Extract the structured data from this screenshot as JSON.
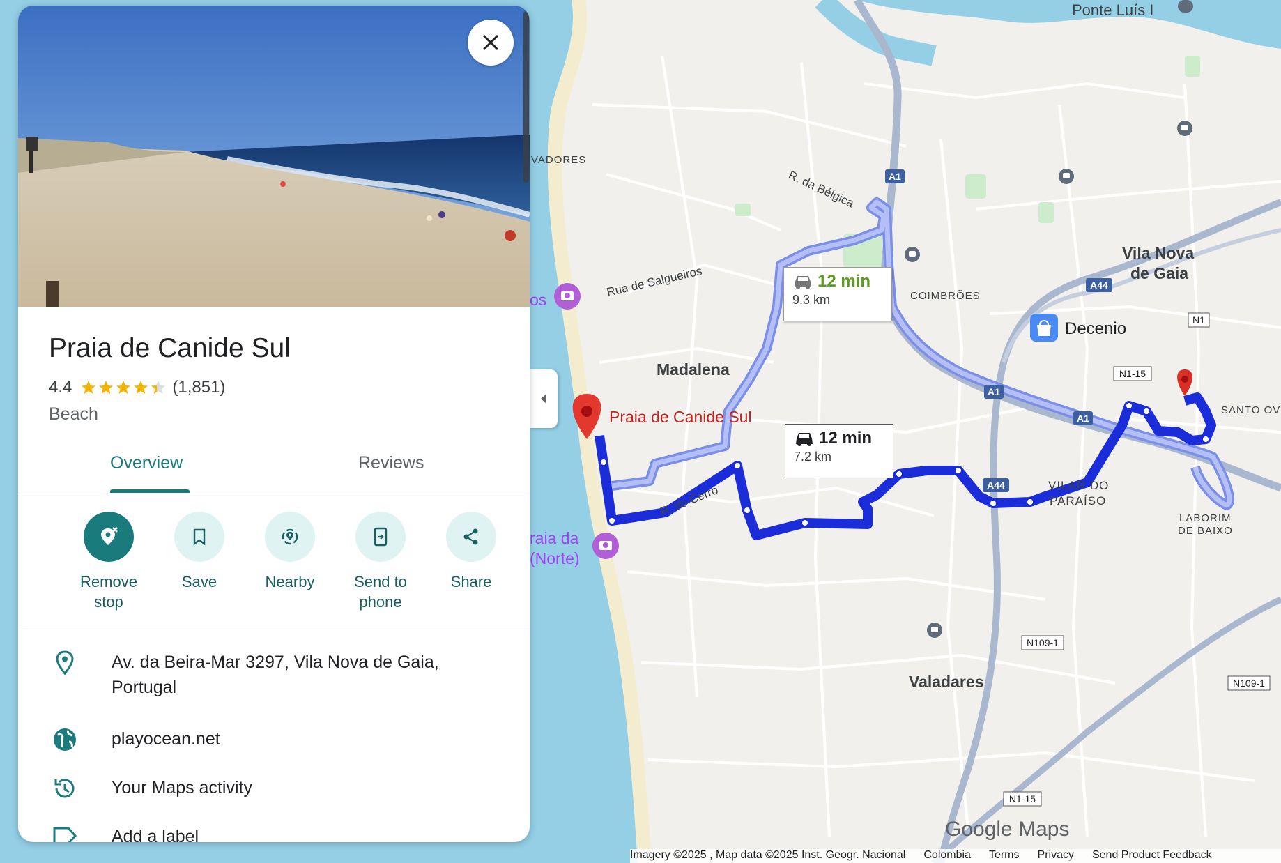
{
  "place": {
    "name": "Praia de Canide Sul",
    "rating": "4.4",
    "stars": 4.4,
    "reviews_count": "(1,851)",
    "category": "Beach"
  },
  "tabs": {
    "overview": "Overview",
    "reviews": "Reviews"
  },
  "actions": [
    {
      "label_line1": "Remove",
      "label_line2": "stop",
      "icon": "remove-stop-icon"
    },
    {
      "label_line1": "Save",
      "label_line2": "",
      "icon": "bookmark-icon"
    },
    {
      "label_line1": "Nearby",
      "label_line2": "",
      "icon": "nearby-icon"
    },
    {
      "label_line1": "Send to",
      "label_line2": "phone",
      "icon": "send-to-phone-icon"
    },
    {
      "label_line1": "Share",
      "label_line2": "",
      "icon": "share-icon"
    }
  ],
  "info": {
    "address": "Av. da Beira-Mar 3297, Vila Nova de Gaia, Portugal",
    "website": "playocean.net",
    "activity": "Your Maps activity",
    "label": "Add a label"
  },
  "routes": [
    {
      "duration": "12 min",
      "distance": "9.3 km",
      "icon": "car-icon",
      "color": "#5b9b1e"
    },
    {
      "duration": "12 min",
      "distance": "7.2 km",
      "icon": "car-icon",
      "color": "#202124"
    }
  ],
  "map_labels": {
    "ponte": "Ponte Luís I",
    "vadores": "VADORES",
    "r_belgica": "R. da Bélgica",
    "rua_salgueiros": "Rua de Salgueiros",
    "madalena": "Madalena",
    "coimbroes": "COIMBRÕES",
    "vila_nova_1": "Vila Nova",
    "vila_nova_2": "de Gaia",
    "decenio": "Decenio",
    "santo_ov": "SANTO OV",
    "laborim_1": "LABORIM",
    "laborim_2": "DE BAIXO",
    "vilar_1": "VILAR DO",
    "vilar_2": "PARAÍSO",
    "r_cerro": "R. do Cerro",
    "praia_norte_1": "raia da",
    "praia_norte_2": "(Norte)",
    "os": "os",
    "valadares": "Valadares",
    "marker_label": "Praia de Canide Sul",
    "google_maps": "Google Maps"
  },
  "road_shields": {
    "a1_top": "A1",
    "a44_top": "A44",
    "n1": "N1",
    "n1_15": "N1-15",
    "a1_mid": "A1",
    "a1_right": "A1",
    "a44_mid": "A44",
    "n109_1": "N109-1",
    "n109_1_right": "N109-1",
    "n1_15_bottom": "N1-15"
  },
  "footer": {
    "imagery": "Imagery ©2025 , Map data ©2025 Inst. Geogr. Nacional",
    "country": "Colombia",
    "terms": "Terms",
    "privacy": "Privacy",
    "feedback": "Send Product Feedback"
  },
  "colors": {
    "accent": "#1a7b7d",
    "route_primary": "#1a2dd8",
    "route_alt": "#8f9ff0",
    "marker": "#d93025",
    "poi_purple": "#b05fd6",
    "water": "#94cfe6"
  }
}
